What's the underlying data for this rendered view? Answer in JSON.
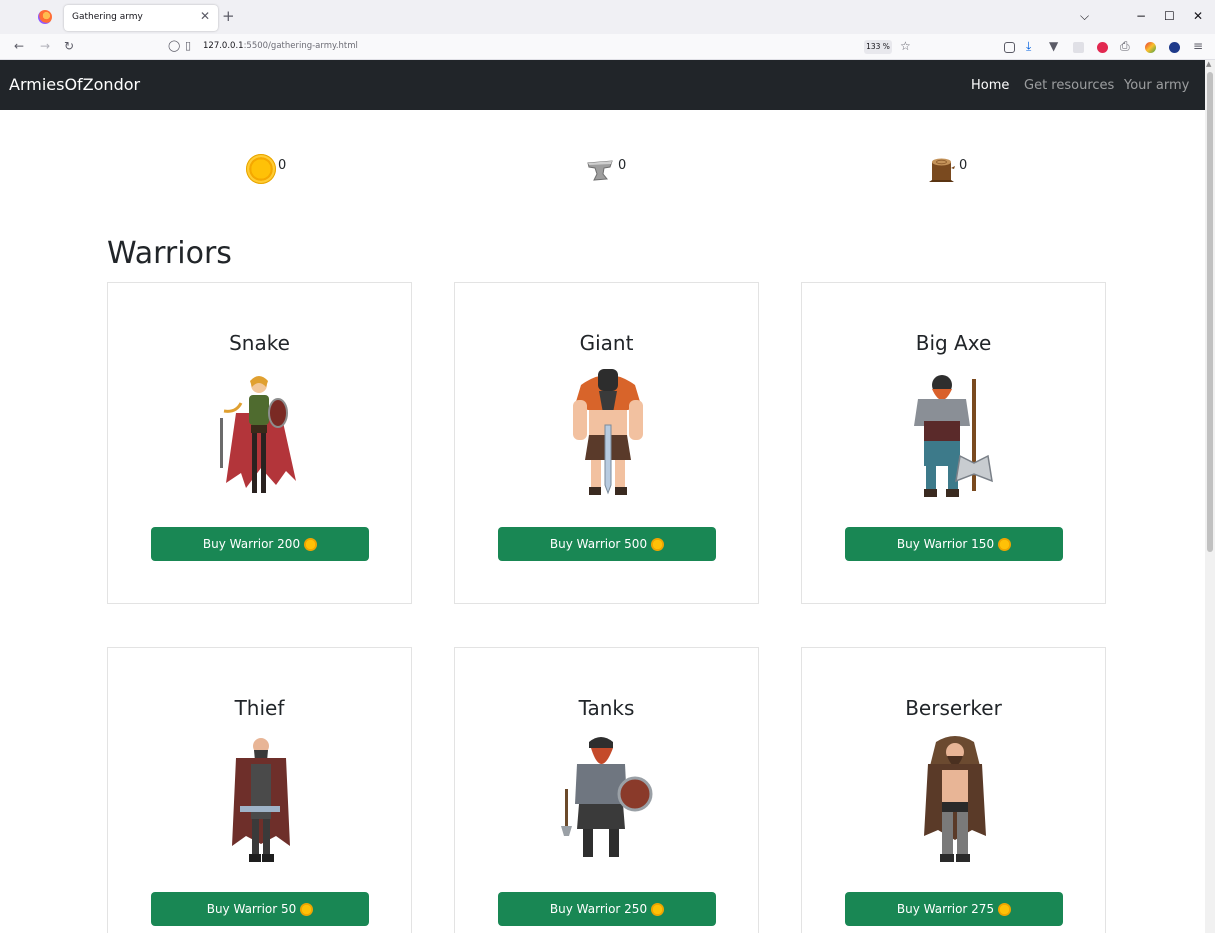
{
  "browser": {
    "tab_title": "Gathering army",
    "url_host": "127.0.0.1",
    "url_rest": ":5500/gathering-army.html",
    "zoom": "133 %"
  },
  "site": {
    "brand": "ArmiesOfZondor",
    "nav": [
      {
        "label": "Home",
        "active": true
      },
      {
        "label": "Get resources",
        "active": false
      },
      {
        "label": "Your army",
        "active": false
      }
    ]
  },
  "resources": {
    "gold": "0",
    "iron": "0",
    "wood": "0"
  },
  "section_title": "Warriors",
  "warriors": [
    {
      "name": "Snake",
      "button": "Buy Warrior 200"
    },
    {
      "name": "Giant",
      "button": "Buy Warrior 500"
    },
    {
      "name": "Big Axe",
      "button": "Buy Warrior 150"
    },
    {
      "name": "Thief",
      "button": "Buy Warrior 50"
    },
    {
      "name": "Tanks",
      "button": "Buy Warrior 250"
    },
    {
      "name": "Berserker",
      "button": "Buy Warrior 275"
    }
  ],
  "colors": {
    "navbar": "#212529",
    "button": "#198754",
    "coin": "#ffc107"
  }
}
